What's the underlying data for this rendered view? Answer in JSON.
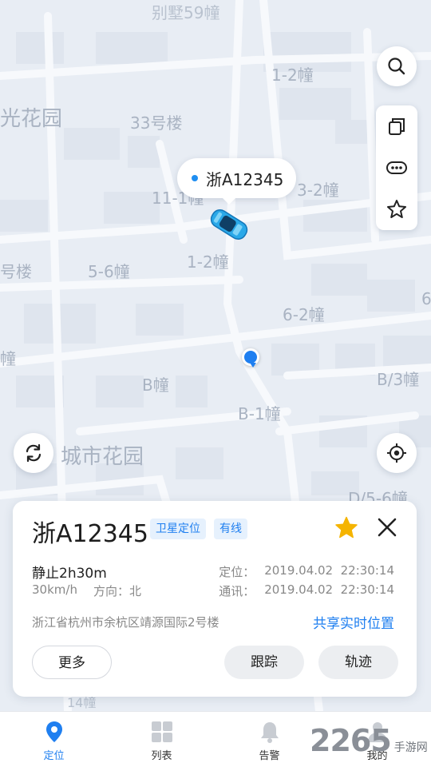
{
  "map": {
    "labels": {
      "top": "别墅59幢",
      "l1": "1-2幢",
      "l2": "光花园",
      "l3": "33号楼",
      "l4": "11-1幢",
      "l5": "3-2幢",
      "l6": "号楼",
      "l7": "5-6幢",
      "l8": "1-2幢",
      "l9": "6-2幢",
      "l10": "6",
      "l11": "幢",
      "l12": "B幢",
      "l13": "B/3幢",
      "l14": "B-1幢",
      "l15": "城市花园",
      "l16": "D/5-6幢",
      "l17": "14幢"
    },
    "vehicle_bubble": {
      "plate": "浙A12345"
    },
    "controls": {
      "search_icon": "search-icon",
      "copy_icon": "copy-icon",
      "more_icon": "more-dots-icon",
      "favorite_icon": "star-outline-icon",
      "refresh_icon": "refresh-icon",
      "locate_icon": "locate-icon"
    }
  },
  "card": {
    "plate": "浙A12345",
    "tags": {
      "gps": "卫星定位",
      "wired": "有线"
    },
    "status": "静止2h30m",
    "speed": "30km/h",
    "direction": "方向：北",
    "locate_label": "定位：",
    "locate_time": "2019.04.02  22:30:14",
    "comm_label": "通讯：",
    "comm_time": "2019.04.02  22:30:14",
    "address": "浙江省杭州市余杭区靖源国际2号楼",
    "share_label": "共享实时位置",
    "buttons": {
      "more": "更多",
      "track": "跟踪",
      "trail": "轨迹"
    },
    "favorited": true
  },
  "tabbar": {
    "items": [
      {
        "label": "定位",
        "icon": "location-pin-icon",
        "active": true
      },
      {
        "label": "列表",
        "icon": "grid-icon",
        "active": false
      },
      {
        "label": "告警",
        "icon": "bell-icon",
        "active": false
      },
      {
        "label": "我的",
        "icon": "person-icon",
        "active": false
      }
    ]
  },
  "watermark": {
    "number": "2265",
    "site": "手游网"
  },
  "colors": {
    "accent": "#1f7ff0",
    "star": "#f5b400",
    "map_bg": "#e8edf4"
  }
}
